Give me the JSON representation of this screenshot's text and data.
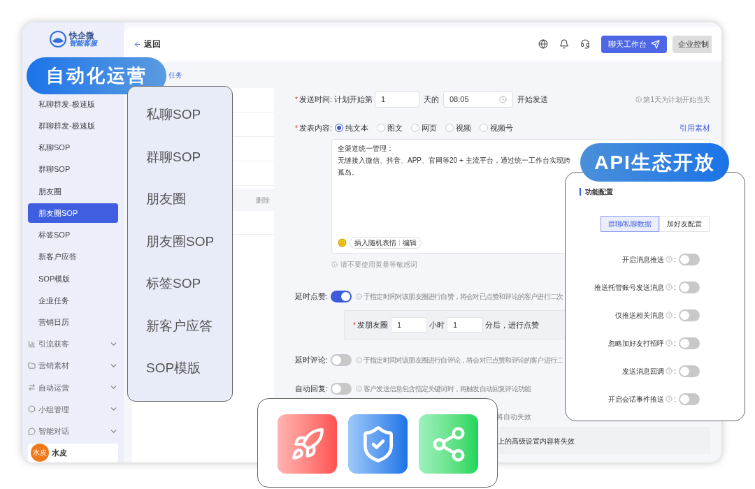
{
  "logo": {
    "name": "快企微",
    "tagline": "智能客服"
  },
  "sidebar": {
    "items": [
      {
        "label": "私聊群发-极速版",
        "selected": false
      },
      {
        "label": "群聊群发-极速版",
        "selected": false
      },
      {
        "label": "私聊SOP",
        "selected": false
      },
      {
        "label": "群聊SOP",
        "selected": false
      },
      {
        "label": "朋友圈",
        "selected": false
      },
      {
        "label": "朋友圈SOP",
        "selected": true
      },
      {
        "label": "标签SOP",
        "selected": false
      },
      {
        "label": "新客户应答",
        "selected": false
      },
      {
        "label": "SOP模版",
        "selected": false
      },
      {
        "label": "企业任务",
        "selected": false
      },
      {
        "label": "营销日历",
        "selected": false
      }
    ],
    "groups": [
      {
        "label": "引流获客",
        "kind": "chart",
        "expanded": false
      },
      {
        "label": "营销素材",
        "kind": "folder",
        "expanded": false
      },
      {
        "label": "自动运营",
        "kind": "swap",
        "expanded": false
      },
      {
        "label": "小组管理",
        "kind": "hexagon",
        "expanded": false
      },
      {
        "label": "智能对话",
        "kind": "chat",
        "expanded": false
      }
    ],
    "user": {
      "avatar_text": "水皮",
      "name": "水皮"
    }
  },
  "header": {
    "back": "返回",
    "primary_button": "聊天工作台",
    "secondary_button": "企业控制"
  },
  "breadcrumb": "任务",
  "list": {
    "action": "删除"
  },
  "form": {
    "send_time": {
      "required_mark": "*",
      "label": "发送时间:",
      "prefix": "计划开始第",
      "day": "1",
      "mid": "天的",
      "time": "08:05",
      "suffix": "开始发送",
      "hint": "第1天为计划开始当天"
    },
    "content": {
      "required_mark": "*",
      "label": "发表内容:",
      "options": [
        {
          "label": "纯文本",
          "selected": true
        },
        {
          "label": "图文",
          "selected": false
        },
        {
          "label": "网页",
          "selected": false
        },
        {
          "label": "视频",
          "selected": false
        },
        {
          "label": "视频号",
          "selected": false
        }
      ],
      "link": "引用素材",
      "text_lines": [
        "全渠道统一管理：",
        "无缝接入微信、抖音、APP、官网等20 + 主流平台，通过统一工作台实现跨",
        "孤岛。"
      ],
      "insert_emoji": "插入随机表情",
      "edit": "编辑",
      "warning": "请不要使用黄暴等敏感词"
    },
    "toggles": [
      {
        "label": "延时点赞:",
        "on": true,
        "hint": "于指定时间对该朋友圈进行自赞，将会对已点赞和评论的客户进行二次"
      },
      {
        "label": "延时评论:",
        "on": false,
        "hint": "于指定时间对该朋友圈进行自评论，将会对已点赞和评论的客户进行二"
      },
      {
        "label": "自动回复:",
        "on": false,
        "hint": "客户发送信息包含指定关键词时，将触发自动回复评论功能"
      }
    ],
    "like_delay": {
      "required_mark": "*",
      "label": "发朋友圈",
      "hours": "1",
      "hours_unit": "小时",
      "minutes": "1",
      "suffix": "分后，进行点赞"
    },
    "fragment_1": "将自动失效",
    "fragment_2": "上的高级设置内容将失效"
  },
  "badge_left": "自动化运营",
  "popup_list": [
    "私聊SOP",
    "群聊SOP",
    "朋友圈",
    "朋友圈SOP",
    "标签SOP",
    "新客户应答",
    "SOP模版"
  ],
  "badge_right": "API生态开放",
  "config_panel": {
    "title": "功能配置",
    "tabs": [
      {
        "label": "群聊/私聊数据",
        "selected": true
      },
      {
        "label": "加好友配置",
        "selected": false
      }
    ],
    "switches": [
      {
        "label": "开启消息推送",
        "colon": ":",
        "on": false
      },
      {
        "label": "推送托管账号发送消息",
        "colon": ":",
        "on": false
      },
      {
        "label": "仅推送相关消息",
        "colon": ":",
        "on": false
      },
      {
        "label": "忽略加好友打招呼",
        "colon": ":",
        "on": false
      },
      {
        "label": "发送消息回调",
        "colon": ":",
        "on": false
      },
      {
        "label": "开启会话事件推送",
        "colon": ":",
        "on": false
      }
    ]
  },
  "app_icons": [
    {
      "kind": "rocket"
    },
    {
      "kind": "shield"
    },
    {
      "kind": "api"
    }
  ]
}
